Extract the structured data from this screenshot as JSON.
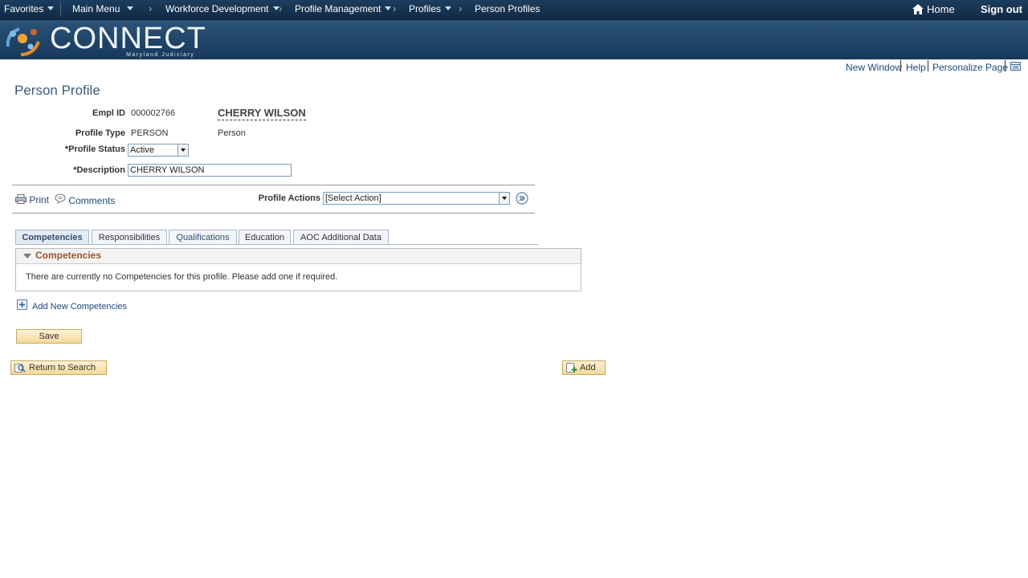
{
  "nav": {
    "favorites": "Favorites",
    "main_menu": "Main Menu",
    "breadcrumb_1": "Workforce Development",
    "breadcrumb_2": "Profile Management",
    "breadcrumb_3": "Profiles",
    "breadcrumb_4": "Person Profiles",
    "home": "Home",
    "sign_out": "Sign out"
  },
  "brand": {
    "name": "CONNECT",
    "subtitle": "Maryland Judiciary"
  },
  "utility": {
    "new_window": "New Window",
    "help": "Help",
    "personalize": "Personalize Page"
  },
  "page": {
    "title": "Person Profile"
  },
  "form": {
    "empl_id_label": "Empl ID",
    "empl_id_value": "000002766",
    "person_name": "CHERRY WILSON",
    "profile_type_label": "Profile Type",
    "profile_type_value": "PERSON",
    "profile_type_desc": "Person",
    "profile_status_label": "*Profile Status",
    "profile_status_value": "Active",
    "description_label": "*Description",
    "description_value": "CHERRY WILSON"
  },
  "toolbar": {
    "print": "Print",
    "comments": "Comments",
    "profile_actions_label": "Profile Actions",
    "profile_actions_value": "[Select Action]"
  },
  "tabs": [
    "Competencies",
    "Responsibilities",
    "Qualifications",
    "Education",
    "AOC Additional Data"
  ],
  "competencies": {
    "title": "Competencies",
    "empty_message": "There are currently no Competencies for this profile.  Please add one if required.",
    "add_link": "Add New Competencies"
  },
  "buttons": {
    "save": "Save",
    "return_to_search": "Return to Search",
    "add": "Add"
  },
  "colors": {
    "header": "#17385a",
    "link": "#1c4a7a",
    "accent": "#a0522d",
    "button": "#f5d99b"
  }
}
